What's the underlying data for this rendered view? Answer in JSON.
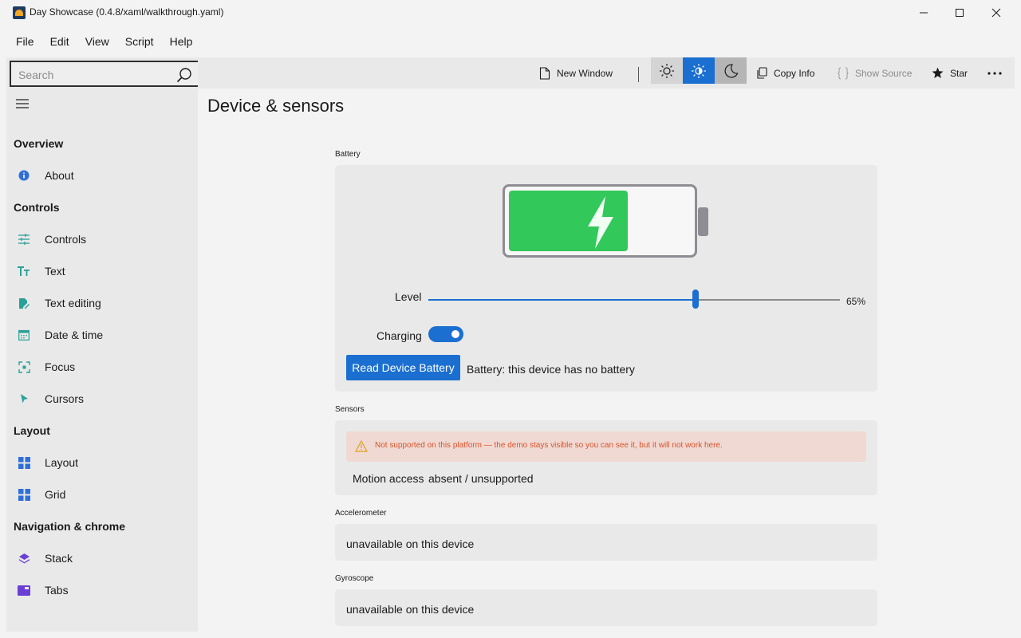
{
  "window": {
    "title": "Day Showcase (0.4.8/xaml/walkthrough.yaml)",
    "minimize_icon": "minimize-icon",
    "maximize_icon": "maximize-icon",
    "close_icon": "close-icon"
  },
  "menu": [
    "File",
    "Edit",
    "View",
    "Script",
    "Help"
  ],
  "search": {
    "placeholder": "Search"
  },
  "sidebar": {
    "sections": [
      {
        "title": "Overview",
        "items": [
          {
            "label": "About",
            "icon": "info-icon",
            "color": "#2f6fd6"
          }
        ]
      },
      {
        "title": "Controls",
        "items": [
          {
            "label": "Controls",
            "icon": "sliders-icon",
            "color": "#2aa198"
          },
          {
            "label": "Text",
            "icon": "text-icon",
            "color": "#2aa198"
          },
          {
            "label": "Text editing",
            "icon": "edit-icon",
            "color": "#2aa198"
          },
          {
            "label": "Date & time",
            "icon": "calendar-icon",
            "color": "#2aa198"
          },
          {
            "label": "Focus",
            "icon": "focus-icon",
            "color": "#2aa198"
          },
          {
            "label": "Cursors",
            "icon": "cursor-icon",
            "color": "#2aa198"
          }
        ]
      },
      {
        "title": "Layout",
        "items": [
          {
            "label": "Layout",
            "icon": "layout-icon",
            "color": "#2f6fd6"
          },
          {
            "label": "Grid",
            "icon": "grid-icon",
            "color": "#2f6fd6"
          }
        ]
      },
      {
        "title": "Navigation & chrome",
        "items": [
          {
            "label": "Stack",
            "icon": "stack-icon",
            "color": "#6b3fd6"
          },
          {
            "label": "Tabs",
            "icon": "tabs-icon",
            "color": "#6b3fd6"
          }
        ]
      }
    ]
  },
  "toolbar": {
    "new_window": "New Window",
    "copy_info": "Copy Info",
    "show_source": "Show Source",
    "star": "Star",
    "theme_active": "auto"
  },
  "page": {
    "title": "Device & sensors",
    "battery": {
      "section": "Battery",
      "level_label": "Level",
      "level_percent": 65,
      "level_text": "65%",
      "charging_label": "Charging",
      "charging": true,
      "read_button": "Read Device Battery",
      "status": "Battery: this device has no battery",
      "fill_color": "#32c85a"
    },
    "sensors": {
      "section": "Sensors",
      "warning": "Not supported on this platform — the demo stays visible so you can see it, but it will not work here.",
      "motion_label": "Motion access",
      "motion_value": "absent / unsupported"
    },
    "accelerometer": {
      "section": "Accelerometer",
      "value": "unavailable on this device"
    },
    "gyroscope": {
      "section": "Gyroscope",
      "value": "unavailable on this device"
    }
  },
  "colors": {
    "accent": "#1b6fd0",
    "warning_bg": "#f0d9d2",
    "warning_text": "#d9532c"
  }
}
